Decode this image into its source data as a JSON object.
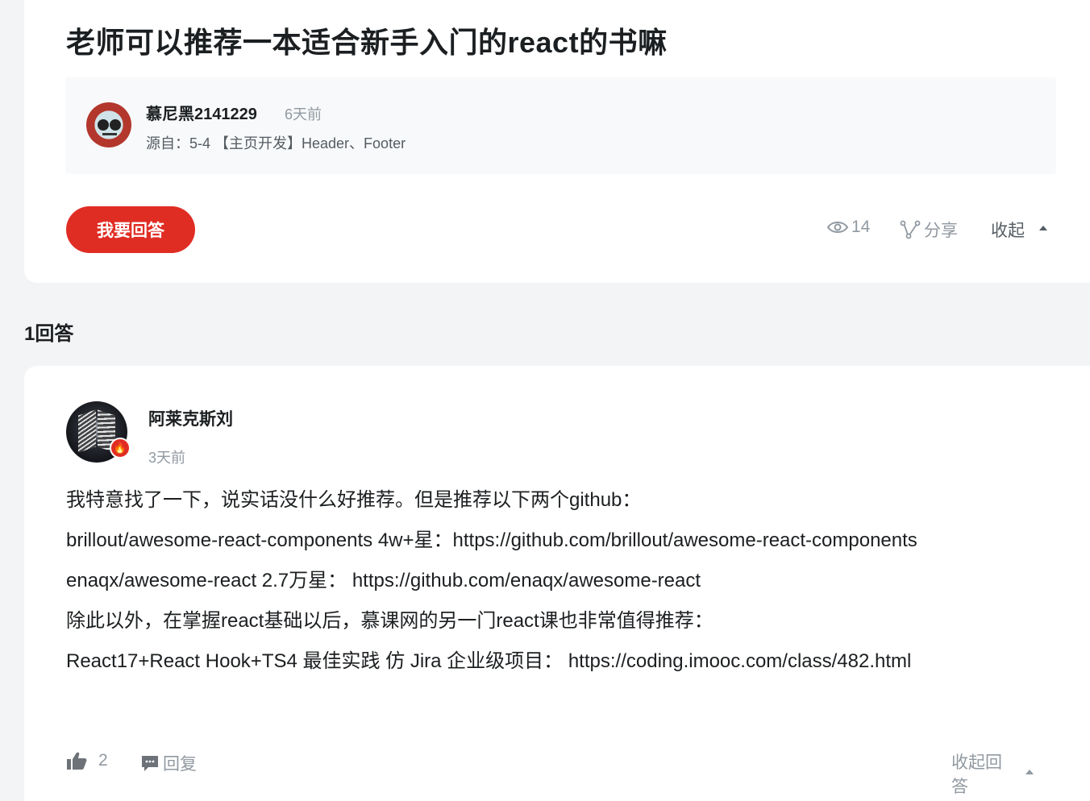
{
  "question": {
    "title": "老师可以推荐一本适合新手入门的react的书嘛",
    "author": {
      "name": "慕尼黑2141229",
      "time": "6天前",
      "source": "源自：5-4 【主页开发】Header、Footer"
    },
    "answer_button": "我要回答",
    "views": "14",
    "share_label": "分享",
    "collapse_label": "收起"
  },
  "answers_header": "1回答",
  "answer": {
    "author": {
      "name": "阿莱克斯刘",
      "time": "3天前"
    },
    "paragraphs": [
      "我特意找了一下，说实话没什么好推荐。但是推荐以下两个github：",
      "brillout/awesome-react-components 4w+星：https://github.com/brillout/awesome-react-components",
      "enaqx/awesome-react 2.7万星： https://github.com/enaqx/awesome-react",
      "除此以外，在掌握react基础以后，慕课网的另一门react课也非常值得推荐：",
      "React17+React Hook+TS4 最佳实践 仿 Jira 企业级项目： https://coding.imooc.com/class/482.html"
    ],
    "likes": "2",
    "reply_label": "回复",
    "collapse_answer_label": "收起回答"
  },
  "colors": {
    "accent": "#e02d24",
    "muted": "#9199a1",
    "background": "#f3f4f6"
  },
  "icons": {
    "views": "eye-icon",
    "share": "share-icon",
    "like": "thumbs-up-icon",
    "reply": "comment-icon",
    "fire": "fire-icon"
  }
}
